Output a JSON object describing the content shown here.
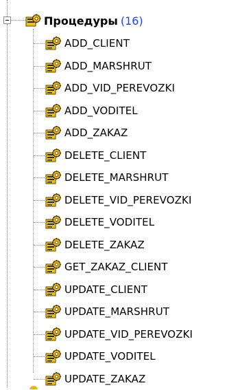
{
  "tree": {
    "root": {
      "label": "Процедуры",
      "count": "(16)",
      "icon": "procedure-folder-icon",
      "expanded": true
    },
    "items": [
      {
        "label": "ADD_CLIENT",
        "icon": "stored-procedure-icon"
      },
      {
        "label": "ADD_MARSHRUT",
        "icon": "stored-procedure-icon"
      },
      {
        "label": "ADD_VID_PEREVOZKI",
        "icon": "stored-procedure-icon"
      },
      {
        "label": "ADD_VODITEL",
        "icon": "stored-procedure-icon"
      },
      {
        "label": "ADD_ZAKAZ",
        "icon": "stored-procedure-icon"
      },
      {
        "label": "DELETE_CLIENT",
        "icon": "stored-procedure-icon"
      },
      {
        "label": "DELETE_MARSHRUT",
        "icon": "stored-procedure-icon"
      },
      {
        "label": "DELETE_VID_PEREVOZKI",
        "icon": "stored-procedure-icon"
      },
      {
        "label": "DELETE_VODITEL",
        "icon": "stored-procedure-icon"
      },
      {
        "label": "DELETE_ZAKAZ",
        "icon": "stored-procedure-icon"
      },
      {
        "label": "GET_ZAKAZ_CLIENT",
        "icon": "stored-procedure-icon"
      },
      {
        "label": "UPDATE_CLIENT",
        "icon": "stored-procedure-icon"
      },
      {
        "label": "UPDATE_MARSHRUT",
        "icon": "stored-procedure-icon"
      },
      {
        "label": "UPDATE_VID_PEREVOZKI",
        "icon": "stored-procedure-icon"
      },
      {
        "label": "UPDATE_VODITEL",
        "icon": "stored-procedure-icon"
      },
      {
        "label": "UPDATE_ZAKAZ",
        "icon": "stored-procedure-icon"
      }
    ],
    "colors": {
      "count_text": "#1e40ff",
      "guide_lines": "#8a8a8a",
      "icon_gold": "#f0b400",
      "icon_dark": "#1a2a5a"
    }
  }
}
